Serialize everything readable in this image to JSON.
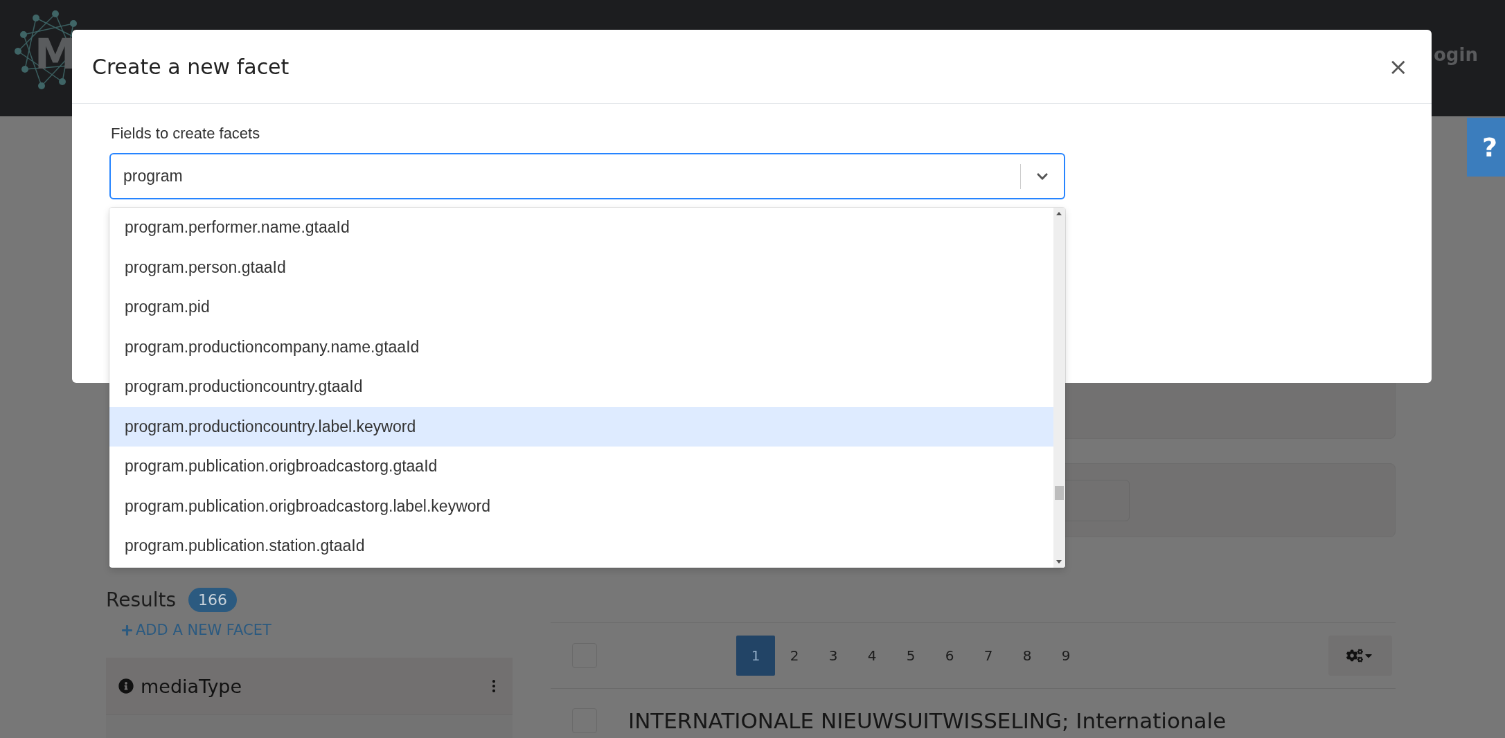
{
  "nav": {
    "logo_letter": "M",
    "login": "ogin"
  },
  "help": {
    "label": "?"
  },
  "modal": {
    "title": "Create a new facet",
    "close": "×",
    "field_label": "Fields to create facets",
    "select": {
      "value": "program",
      "expanded": true
    },
    "options": [
      {
        "label": "program.performer.name.gtaaId",
        "highlighted": false
      },
      {
        "label": "program.person.gtaaId",
        "highlighted": false
      },
      {
        "label": "program.pid",
        "highlighted": false
      },
      {
        "label": "program.productioncompany.name.gtaaId",
        "highlighted": false
      },
      {
        "label": "program.productioncountry.gtaaId",
        "highlighted": false
      },
      {
        "label": "program.productioncountry.label.keyword",
        "highlighted": true
      },
      {
        "label": "program.publication.origbroadcastorg.gtaaId",
        "highlighted": false
      },
      {
        "label": "program.publication.origbroadcastorg.label.keyword",
        "highlighted": false
      },
      {
        "label": "program.publication.station.gtaaId",
        "highlighted": false
      }
    ]
  },
  "results": {
    "label": "Results",
    "count": "166",
    "add_facet": "ADD A NEW FACET",
    "facets": [
      {
        "name": "mediaType"
      }
    ]
  },
  "select_all": {
    "checked": false
  },
  "pagination": [
    {
      "label": "1",
      "selected": true
    },
    {
      "label": "2",
      "selected": false
    },
    {
      "label": "3",
      "selected": false
    },
    {
      "label": "4",
      "selected": false
    },
    {
      "label": "5",
      "selected": false
    },
    {
      "label": "6",
      "selected": false
    },
    {
      "label": "7",
      "selected": false
    },
    {
      "label": "8",
      "selected": false
    },
    {
      "label": "9",
      "selected": false
    }
  ],
  "result_rows": [
    {
      "title": "INTERNATIONALE NIEUWSUITWISSELING; Internationale",
      "checked": false
    }
  ]
}
